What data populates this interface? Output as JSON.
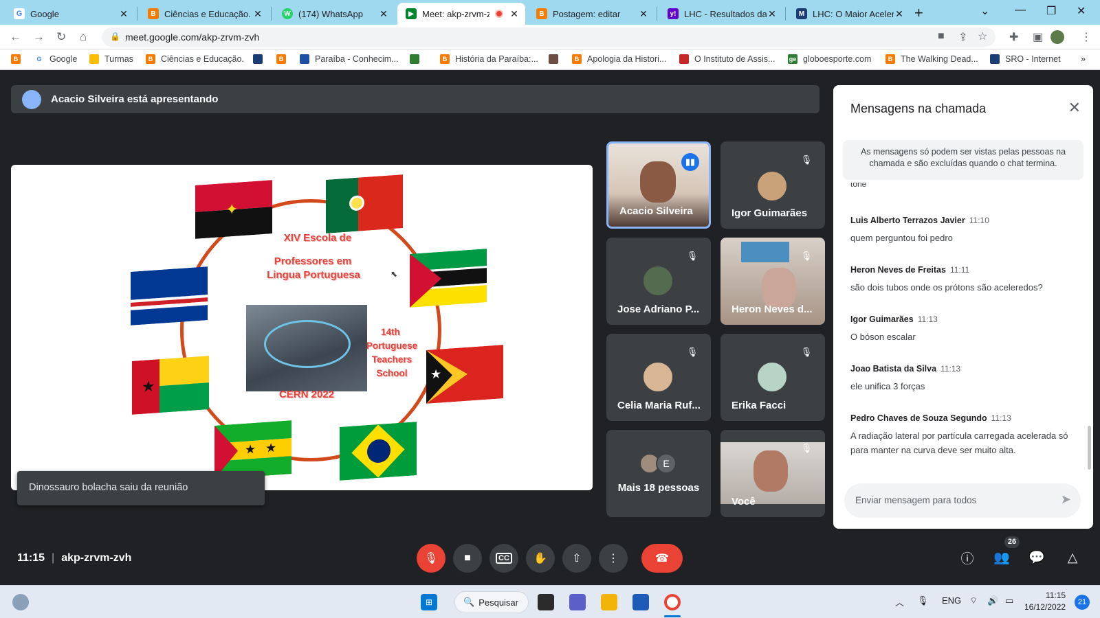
{
  "browser": {
    "tabs": [
      {
        "label": "Google",
        "icon": "google-icon",
        "color": "#4285f4"
      },
      {
        "label": "Ciências e Educação.",
        "icon": "blogger-icon",
        "color": "#f57c00"
      },
      {
        "label": "(174) WhatsApp",
        "icon": "whatsapp-icon",
        "color": "#25d366"
      },
      {
        "label": "Meet: akp-zrvm-z",
        "icon": "meet-icon",
        "color": "#00832d",
        "active": true
      },
      {
        "label": "Postagem: editar",
        "icon": "blogger-icon",
        "color": "#f57c00"
      },
      {
        "label": "LHC - Resultados da b",
        "icon": "yahoo-icon",
        "color": "#6001d2"
      },
      {
        "label": "LHC: O Maior Acelera",
        "icon": "site-icon",
        "color": "#1c3d74"
      }
    ],
    "close_glyph": "✕",
    "new_tab_glyph": "+",
    "url": "meet.google.com/akp-zrvm-zvh",
    "bookmarks": [
      {
        "label": "",
        "icon": "blogger-icon",
        "color": "#f57c00"
      },
      {
        "label": "Google",
        "icon": "google-icon",
        "color": "#4285f4"
      },
      {
        "label": "Turmas",
        "icon": "classroom-icon",
        "color": "#fbbc04"
      },
      {
        "label": "Ciências e Educação.",
        "icon": "blogger-icon",
        "color": "#f57c00"
      },
      {
        "label": "",
        "icon": "site-icon",
        "color": "#1c3d74"
      },
      {
        "label": "",
        "icon": "blogger-icon",
        "color": "#f57c00"
      },
      {
        "label": "Paraíba - Conhecim...",
        "icon": "site-icon",
        "color": "#1f4fa3"
      },
      {
        "label": "",
        "icon": "flag-icon",
        "color": "#2e7d32"
      },
      {
        "label": "História da Paraíba:...",
        "icon": "blogger-icon",
        "color": "#f57c00"
      },
      {
        "label": "",
        "icon": "site-icon",
        "color": "#6d4c41"
      },
      {
        "label": "Apologia da Histori...",
        "icon": "blogger-icon",
        "color": "#f57c00"
      },
      {
        "label": "O Instituto de Assis...",
        "icon": "site-icon",
        "color": "#c62828"
      },
      {
        "label": "globoesporte.com",
        "icon": "ge-icon",
        "color": "#2e7d32"
      },
      {
        "label": "The Walking Dead...",
        "icon": "blogger-icon",
        "color": "#f57c00"
      },
      {
        "label": "SRO - Internet",
        "icon": "site-icon",
        "color": "#1c3d74"
      }
    ],
    "more_glyph": "»"
  },
  "meet": {
    "presenting_text": "Acacio Silveira está apresentando",
    "slide": {
      "title_line1": "XIV Escola de",
      "title_line2": "Professores em",
      "title_line3": "Lingua Portuguesa",
      "subtitle_line1": "14th",
      "subtitle_line2": "Portuguese",
      "subtitle_line3": "Teachers",
      "subtitle_line4": "School",
      "footer": "CERN 2022"
    },
    "participants": [
      {
        "name": "Acacio Silveira",
        "status": "speaking"
      },
      {
        "name": "Igor Guimarães",
        "status": "muted"
      },
      {
        "name": "Jose Adriano P...",
        "status": "muted"
      },
      {
        "name": "Heron Neves d...",
        "status": "muted"
      },
      {
        "name": "Celia Maria Ruf...",
        "status": "muted"
      },
      {
        "name": "Erika Facci",
        "status": "muted"
      },
      {
        "name": "Mais 18 pessoas",
        "status": "",
        "avatar_letter": "E"
      },
      {
        "name": "Você",
        "status": "muted"
      }
    ],
    "toast": "Dinossauro bolacha saiu da reunião",
    "time": "11:15",
    "meeting_code": "akp-zrvm-zvh",
    "people_count": "26"
  },
  "chat": {
    "title": "Mensagens na chamada",
    "notice": "As mensagens só podem ser vistas pelas pessoas na chamada e são excluídas quando o chat termina.",
    "partial_text": "tone",
    "messages": [
      {
        "sender": "Luis Alberto Terrazos Javier",
        "time": "11:10",
        "text": "quem perguntou foi pedro"
      },
      {
        "sender": "Heron Neves de Freitas",
        "time": "11:11",
        "text": "são dois tubos onde os prótons são aceleredos?"
      },
      {
        "sender": "Igor Guimarães",
        "time": "11:13",
        "text": "O bóson escalar"
      },
      {
        "sender": "Joao Batista da Silva",
        "time": "11:13",
        "text": "ele unifica 3 forças"
      },
      {
        "sender": "Pedro Chaves de Souza Segundo",
        "time": "11:13",
        "text": "A radiação lateral por partícula carregada  acelerada só para manter na curva deve ser muito alta."
      }
    ],
    "input_placeholder": "Enviar mensagem para todos"
  },
  "taskbar": {
    "search_label": "Pesquisar",
    "lang": "ENG",
    "time": "11:15",
    "date": "16/12/2022",
    "notifications": "21"
  }
}
